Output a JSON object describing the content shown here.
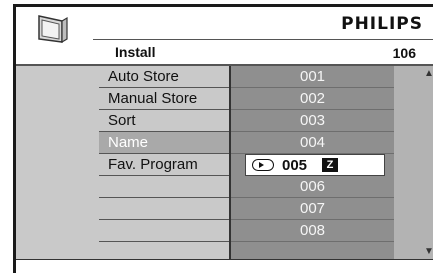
{
  "header": {
    "brand": "PHILIPS",
    "menu_title": "Install",
    "program_number": "106"
  },
  "menu": {
    "items": [
      {
        "label": "Auto Store"
      },
      {
        "label": "Manual Store"
      },
      {
        "label": "Sort"
      },
      {
        "label": "Name"
      },
      {
        "label": "Fav. Program"
      }
    ],
    "selected_index": 3
  },
  "program_list": {
    "rows": [
      "001",
      "002",
      "003",
      "004",
      "005",
      "006",
      "007",
      "008"
    ],
    "selected_index": 4,
    "selected_badge": "Z"
  },
  "icons": {
    "tv": "tv-icon",
    "ok_button": "ok-button-icon",
    "scroll_up": "scroll-up-arrow-icon",
    "scroll_down": "scroll-down-arrow-icon"
  },
  "colors": {
    "menu_background": "#c9c9c9",
    "list_background": "#8f8f8f",
    "selected_menu_background": "#a9a9a9",
    "selected_row_background": "#ffffff"
  }
}
